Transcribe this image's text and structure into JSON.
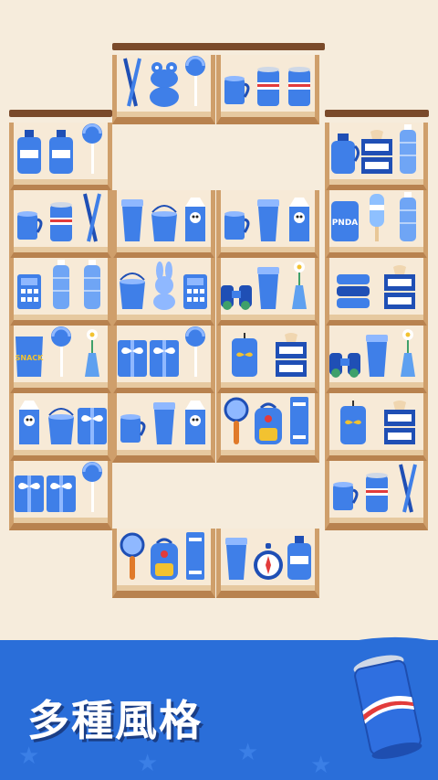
{
  "banner": {
    "title": "多種風格"
  },
  "colors": {
    "shelf_wood": "#cf9f6b",
    "shelf_shadow": "#b8824f",
    "banner_blue": "#2a6ed9",
    "item_blue": "#3f7fe8"
  },
  "shelves": [
    {
      "row": 0,
      "col": 1,
      "items": [
        "toothbrush-cup",
        "frog-toy",
        "lollipop"
      ]
    },
    {
      "row": 0,
      "col": 2,
      "items": [
        "mug",
        "soda-can",
        "soda-can"
      ]
    },
    {
      "row": 1,
      "col": 0,
      "items": [
        "dawn-bottle",
        "dawn-bottle",
        "lollipop"
      ]
    },
    {
      "row": 1,
      "col": 3,
      "items": [
        "jug",
        "tissue-box",
        "water-bottle"
      ]
    },
    {
      "row": 2,
      "col": 0,
      "items": [
        "mug",
        "soda-can",
        "toothbrush-cup"
      ]
    },
    {
      "row": 2,
      "col": 1,
      "items": [
        "coffee-cup",
        "bucket",
        "milk-carton"
      ]
    },
    {
      "row": 2,
      "col": 2,
      "items": [
        "mug-stack",
        "tumbler",
        "milk-carton"
      ]
    },
    {
      "row": 2,
      "col": 3,
      "items": [
        "panda-can",
        "popsicle",
        "water-bottle"
      ]
    },
    {
      "row": 3,
      "col": 0,
      "items": [
        "calculator",
        "water-bottle",
        "water-bottle"
      ]
    },
    {
      "row": 3,
      "col": 1,
      "items": [
        "bucket",
        "bunny-toy",
        "calculator"
      ]
    },
    {
      "row": 3,
      "col": 2,
      "items": [
        "binoculars",
        "tumbler",
        "flower-vase"
      ]
    },
    {
      "row": 3,
      "col": 3,
      "items": [
        "towel-stack",
        "tissue-box"
      ]
    },
    {
      "row": 4,
      "col": 0,
      "items": [
        "snack-bag",
        "lollipop",
        "flower-vase"
      ]
    },
    {
      "row": 4,
      "col": 1,
      "items": [
        "gift-box",
        "gift-box",
        "lollipop"
      ]
    },
    {
      "row": 4,
      "col": 2,
      "items": [
        "candle",
        "tissue-box"
      ]
    },
    {
      "row": 4,
      "col": 3,
      "items": [
        "binoculars",
        "tumbler",
        "flower-vase"
      ]
    },
    {
      "row": 5,
      "col": 0,
      "items": [
        "milk-carton",
        "bucket",
        "gift-box"
      ]
    },
    {
      "row": 5,
      "col": 1,
      "items": [
        "mug-stack",
        "tumbler",
        "milk-carton"
      ]
    },
    {
      "row": 5,
      "col": 2,
      "items": [
        "magnifier",
        "backpack",
        "book"
      ]
    },
    {
      "row": 5,
      "col": 3,
      "items": [
        "candle",
        "tissue-box"
      ]
    },
    {
      "row": 6,
      "col": 0,
      "items": [
        "gift-box",
        "gift-box",
        "lollipop"
      ]
    },
    {
      "row": 6,
      "col": 3,
      "items": [
        "mug",
        "soda-can",
        "toothbrush-cup"
      ]
    },
    {
      "row": 7,
      "col": 1,
      "items": [
        "magnifier",
        "backpack",
        "book"
      ]
    },
    {
      "row": 7,
      "col": 2,
      "items": [
        "tumbler",
        "compass",
        "dawn-bottle"
      ]
    }
  ]
}
